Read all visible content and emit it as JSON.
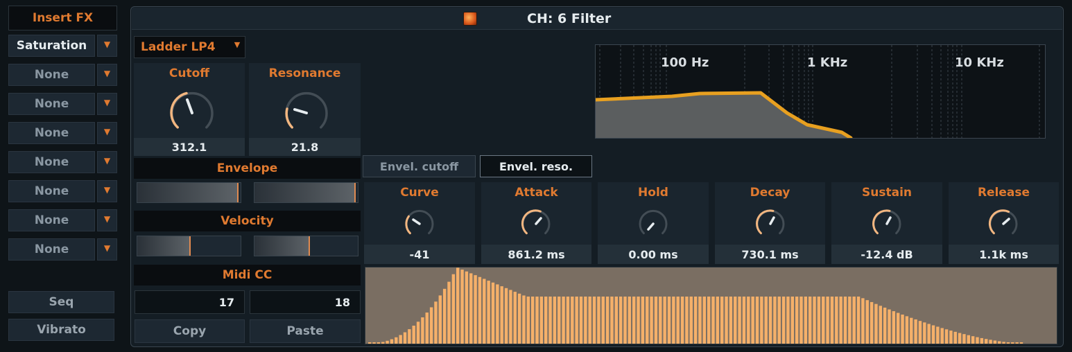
{
  "sidebar": {
    "insert_fx": "Insert FX",
    "slots": [
      "Saturation",
      "None",
      "None",
      "None",
      "None",
      "None",
      "None",
      "None"
    ],
    "seq": "Seq",
    "vibrato": "Vibrato"
  },
  "header": {
    "title": "CH: 6   Filter"
  },
  "filter": {
    "type": "Ladder LP4",
    "cutoff": {
      "label": "Cutoff",
      "value": "312.1"
    },
    "resonance": {
      "label": "Resonance",
      "value": "21.8"
    }
  },
  "envelope_section": {
    "label": "Envelope",
    "cutoff_amount": 0.98,
    "reso_amount": 0.98
  },
  "velocity_section": {
    "label": "Velocity",
    "cutoff_amount": 0.52,
    "reso_amount": 0.54
  },
  "midi_cc": {
    "label": "Midi CC",
    "cutoff_cc": "17",
    "reso_cc": "18",
    "copy": "Copy",
    "paste": "Paste"
  },
  "graph": {
    "labels": [
      "100 Hz",
      "1 KHz",
      "10 KHz"
    ]
  },
  "env_tabs": [
    {
      "label": "Envel. cutoff",
      "active": false
    },
    {
      "label": "Envel. reso.",
      "active": true
    }
  ],
  "env_params": [
    {
      "label": "Curve",
      "value": "-41"
    },
    {
      "label": "Attack",
      "value": "861.2 ms"
    },
    {
      "label": "Hold",
      "value": "0.00 ms"
    },
    {
      "label": "Decay",
      "value": "730.1 ms"
    },
    {
      "label": "Sustain",
      "value": "-12.4 dB"
    },
    {
      "label": "Release",
      "value": "1.1k ms"
    }
  ],
  "colors": {
    "accent": "#e07a30",
    "curve": "#e8a020",
    "bars": "#f5b06a"
  }
}
